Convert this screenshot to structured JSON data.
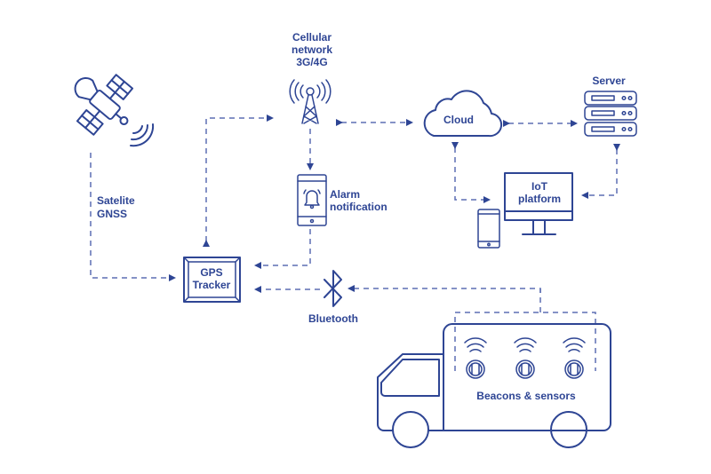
{
  "color": "#2e4594",
  "nodes": {
    "satellite": {
      "label_lines": [
        "Satelite",
        "GNSS"
      ],
      "icon": "satellite-icon"
    },
    "cellular": {
      "label_lines": [
        "Cellular",
        "network",
        "3G/4G"
      ],
      "icon": "cell-tower-icon"
    },
    "alarm": {
      "label_lines": [
        "Alarm",
        "notification"
      ],
      "icon": "phone-bell-icon"
    },
    "tracker": {
      "label_lines": [
        "GPS",
        "Tracker"
      ]
    },
    "bluetooth": {
      "label": "Bluetooth",
      "icon": "bluetooth-icon"
    },
    "cloud": {
      "label": "Cloud",
      "icon": "cloud-icon"
    },
    "server": {
      "label": "Server",
      "icon": "server-icon"
    },
    "iot": {
      "label_lines": [
        "IoT",
        "platform"
      ],
      "icon": "monitor-icon"
    },
    "truck": {
      "label": "Beacons & sensors",
      "icon": "truck-icon"
    }
  }
}
